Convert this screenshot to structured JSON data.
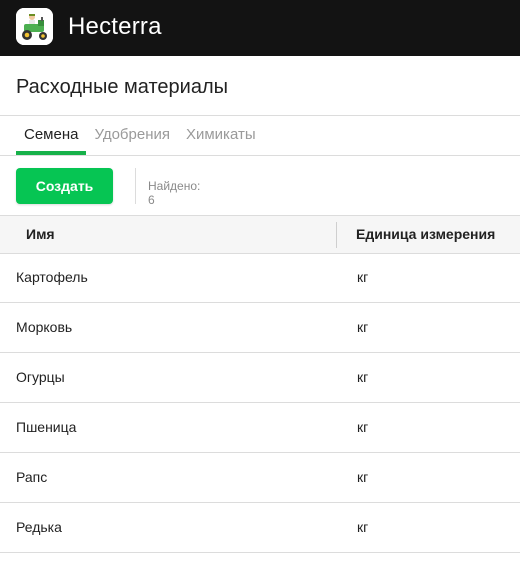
{
  "header": {
    "app_title": "Hecterra",
    "logo_icon": "tractor-farmer-logo-icon"
  },
  "page": {
    "title": "Расходные материалы"
  },
  "tabs": [
    {
      "label": "Семена",
      "active": true
    },
    {
      "label": "Удобрения",
      "active": false
    },
    {
      "label": "Химикаты",
      "active": false
    }
  ],
  "toolbar": {
    "create_label": "Создать",
    "found_text": "Найдено: 6"
  },
  "table": {
    "columns": [
      "Имя",
      "Единица измерения"
    ],
    "rows": [
      {
        "name": "Картофель",
        "unit": "кг"
      },
      {
        "name": "Морковь",
        "unit": "кг"
      },
      {
        "name": "Огурцы",
        "unit": "кг"
      },
      {
        "name": "Пшеница",
        "unit": "кг"
      },
      {
        "name": "Рапс",
        "unit": "кг"
      },
      {
        "name": "Редька",
        "unit": "кг"
      }
    ]
  },
  "colors": {
    "accent": "#06c553",
    "tab_underline": "#17b14a",
    "topbar": "#131313"
  }
}
